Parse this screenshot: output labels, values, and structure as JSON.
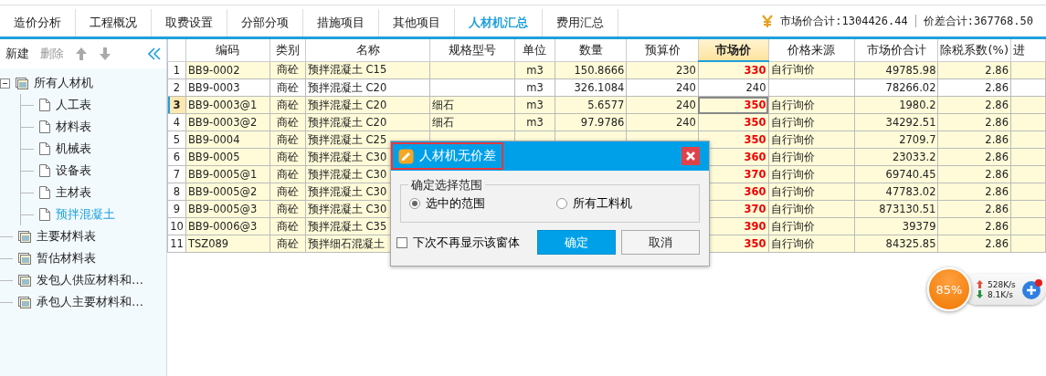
{
  "tabs": [
    {
      "label": "造价分析",
      "selected": false
    },
    {
      "label": "工程概况",
      "selected": false
    },
    {
      "label": "取费设置",
      "selected": false
    },
    {
      "label": "分部分项",
      "selected": false
    },
    {
      "label": "措施项目",
      "selected": false
    },
    {
      "label": "其他项目",
      "selected": false
    },
    {
      "label": "人材机汇总",
      "selected": true
    },
    {
      "label": "费用汇总",
      "selected": false
    }
  ],
  "summary": {
    "market_total": "市场价合计:1304426.44",
    "diff_total": "价差合计:367768.50"
  },
  "sidebar": {
    "toolbar": [
      {
        "label": "新建",
        "disabled": false
      },
      {
        "label": "删除",
        "disabled": true
      }
    ],
    "tree": [
      {
        "label": "所有人材机",
        "expanded": true,
        "selected": false,
        "children": [
          {
            "label": "人工表",
            "selected": false
          },
          {
            "label": "材料表",
            "selected": false
          },
          {
            "label": "机械表",
            "selected": false
          },
          {
            "label": "设备表",
            "selected": false
          },
          {
            "label": "主材表",
            "selected": false
          },
          {
            "label": "预拌混凝土",
            "selected": true
          }
        ]
      },
      {
        "label": "主要材料表",
        "selected": false
      },
      {
        "label": "暂估材料表",
        "selected": false
      },
      {
        "label": "发包人供应材料和…",
        "selected": false
      },
      {
        "label": "承包人主要材料和…",
        "selected": false
      }
    ]
  },
  "table": {
    "columns": [
      {
        "label": "编码",
        "selected": false
      },
      {
        "label": "类别",
        "selected": false
      },
      {
        "label": "名称",
        "selected": false
      },
      {
        "label": "规格型号",
        "selected": false
      },
      {
        "label": "单位",
        "selected": false
      },
      {
        "label": "数量",
        "selected": false
      },
      {
        "label": "预算价",
        "selected": false
      },
      {
        "label": "市场价",
        "selected": true
      },
      {
        "label": "价格来源",
        "selected": false
      },
      {
        "label": "市场价合计",
        "selected": false
      },
      {
        "label": "除税系数(%)",
        "selected": false
      },
      {
        "label": "进",
        "selected": false
      }
    ],
    "rows": [
      {
        "no": "1",
        "selected": false,
        "changed": true,
        "code": "BB9-0002",
        "type": "商砼",
        "name": "预拌混凝土 C15",
        "unit": "m3",
        "qty": "150.8666",
        "budget": "230",
        "market": "330",
        "source": "自行询价",
        "total": "49785.98",
        "tax": "2.86"
      },
      {
        "no": "2",
        "selected": false,
        "changed": false,
        "code": "BB9-0003",
        "type": "商砼",
        "name": "预拌混凝土 C20",
        "unit": "m3",
        "qty": "326.1084",
        "budget": "240",
        "market": "240",
        "total": "78266.02",
        "tax": "2.86"
      },
      {
        "no": "3",
        "selected": true,
        "changed": true,
        "code": "BB9-0003@1",
        "type": "商砼",
        "name": "预拌混凝土 C20",
        "spec": "细石",
        "unit": "m3",
        "qty": "5.6577",
        "budget": "240",
        "market": "350",
        "source": "自行询价",
        "total": "1980.2",
        "tax": "2.86"
      },
      {
        "no": "4",
        "selected": false,
        "changed": true,
        "code": "BB9-0003@2",
        "type": "商砼",
        "name": "预拌混凝土 C20",
        "spec": "细石",
        "unit": "m3",
        "qty": "97.9786",
        "budget": "240",
        "market": "350",
        "source": "自行询价",
        "total": "34292.51",
        "tax": "2.86"
      },
      {
        "no": "5",
        "selected": false,
        "changed": true,
        "code": "BB9-0004",
        "type": "商砼",
        "name": "预拌混凝土 C25",
        "market": "350",
        "source": "自行询价",
        "total": "2709.7",
        "tax": "2.86"
      },
      {
        "no": "6",
        "selected": false,
        "changed": true,
        "code": "BB9-0005",
        "type": "商砼",
        "name": "预拌混凝土 C30",
        "market": "360",
        "source": "自行询价",
        "total": "23033.2",
        "tax": "2.86"
      },
      {
        "no": "7",
        "selected": false,
        "changed": true,
        "code": "BB9-0005@1",
        "type": "商砼",
        "name": "预拌混凝土 C30",
        "market": "370",
        "source": "自行询价",
        "total": "69740.45",
        "tax": "2.86"
      },
      {
        "no": "8",
        "selected": false,
        "changed": true,
        "code": "BB9-0005@2",
        "type": "商砼",
        "name": "预拌混凝土 C30",
        "market": "360",
        "source": "自行询价",
        "total": "47783.02",
        "tax": "2.86"
      },
      {
        "no": "9",
        "selected": false,
        "changed": true,
        "code": "BB9-0005@3",
        "type": "商砼",
        "name": "预拌混凝土 C30",
        "market": "370",
        "source": "自行询价",
        "total": "873130.51",
        "tax": "2.86"
      },
      {
        "no": "10",
        "selected": false,
        "changed": true,
        "code": "BB9-0006@3",
        "type": "商砼",
        "name": "预拌混凝土 C35",
        "market": "390",
        "source": "自行询价",
        "total": "39379",
        "tax": "2.86"
      },
      {
        "no": "11",
        "selected": false,
        "changed": true,
        "code": "TSZ089",
        "type": "商砼",
        "name": "预拌细石混凝土",
        "market": "350",
        "source": "自行询价",
        "total": "84325.85",
        "tax": "2.86"
      }
    ]
  },
  "dialog": {
    "title": "人材机无价差",
    "group_title": "确定选择范围",
    "options": [
      {
        "label": "选中的范围",
        "selected": true
      },
      {
        "label": "所有工料机",
        "selected": false
      }
    ],
    "dont_show": {
      "label": "下次不再显示该窗体",
      "checked": false
    },
    "buttons": [
      {
        "label": "确定",
        "primary": true
      },
      {
        "label": "取消",
        "primary": false
      }
    ]
  },
  "speed_widget": {
    "percent": "85%",
    "upload": "528K/s",
    "download": "8.1K/s"
  }
}
